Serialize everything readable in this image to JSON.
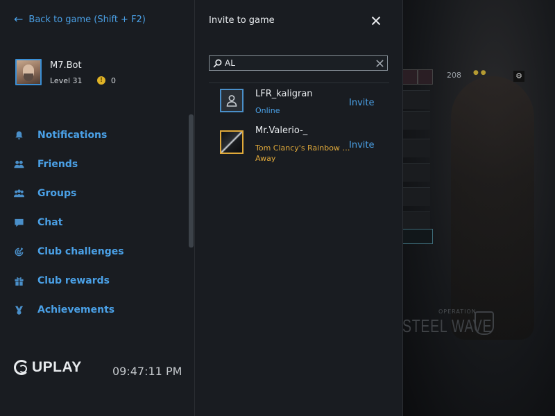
{
  "sidebar": {
    "back_label": "Back to game (Shift + F2)",
    "profile": {
      "username": "M7.Bot",
      "level": "Level 31",
      "coins": "0"
    },
    "nav": [
      {
        "label": "Notifications",
        "icon": "bell-icon"
      },
      {
        "label": "Friends",
        "icon": "friends-icon"
      },
      {
        "label": "Groups",
        "icon": "groups-icon"
      },
      {
        "label": "Chat",
        "icon": "chat-icon"
      },
      {
        "label": "Club challenges",
        "icon": "target-icon"
      },
      {
        "label": "Club rewards",
        "icon": "gift-icon"
      },
      {
        "label": "Achievements",
        "icon": "medal-icon"
      }
    ],
    "logo_text": "UPLAY",
    "clock": "09:47:11 PM"
  },
  "invite": {
    "title": "Invite to game",
    "search_value": "AL",
    "friends": [
      {
        "name": "LFR_kaligran",
        "status": "Online",
        "action": "Invite"
      },
      {
        "name": "Mr.Valerio-_",
        "game": "Tom Clancy's Rainbow Six Siege",
        "status": "Away",
        "action": "Invite"
      }
    ]
  },
  "background": {
    "hud_number": "208",
    "operation_label": "OPERATION",
    "operation_name": "STEEL WAVE"
  },
  "colors": {
    "accent": "#4aa0e6",
    "away": "#e0a93a",
    "panel": "#191c21"
  }
}
